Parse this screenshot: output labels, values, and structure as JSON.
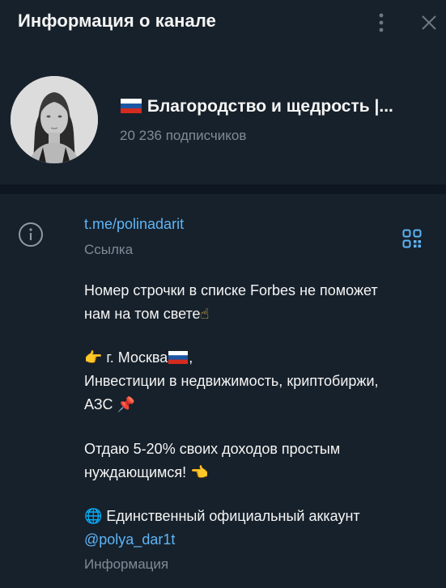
{
  "header": {
    "title": "Информация о канале",
    "more_icon": "vertical-dots-icon",
    "close_icon": "close-icon"
  },
  "profile": {
    "name": "Благородство и щедрость |...",
    "flag_icon": "russia-flag-icon",
    "subscribers": "20 236 подписчиков"
  },
  "info": {
    "link": "t.me/polinadarit",
    "link_label": "Ссылка",
    "description": {
      "line1": "Номер строчки в списке Forbes не поможет",
      "line2": "нам на том свете",
      "emoji_hand_up": "☝",
      "emoji_point_right": "👉",
      "city": " г. Москва",
      "city_suffix": ",",
      "line4": "Инвестиции в недвижимость, криптобиржи,",
      "line5": "АЗС ",
      "emoji_pin": "📌",
      "line6": "Отдаю 5-20% своих доходов простым",
      "line7": "нуждающимся! ",
      "emoji_point_left": "👈",
      "emoji_globe": "🌐",
      "line8": " Единственный официальный аккаунт",
      "mention": "@polya_dar1t"
    },
    "info_label": "Информация"
  },
  "colors": {
    "background": "#17212b",
    "divider": "#0e1621",
    "accent": "#5eb5f7",
    "secondary_text": "#7f8b96"
  }
}
